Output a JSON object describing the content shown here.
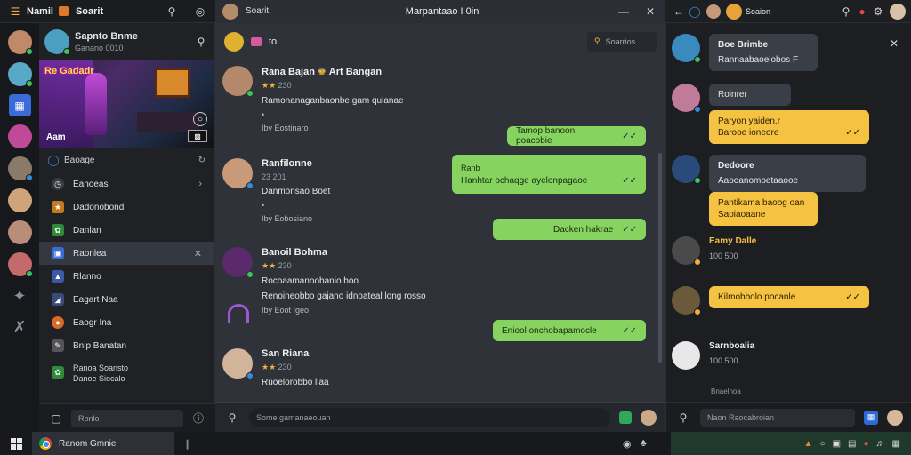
{
  "app": {
    "title": "Namil",
    "section": "Soarit"
  },
  "window": {
    "title": "Marpantaao I 0in"
  },
  "channel": {
    "name": "to"
  },
  "search": {
    "label": "Soarrios"
  },
  "top_right": {
    "label": "Soaion"
  },
  "sidebar": {
    "header": {
      "title": "Sapnto Bnme",
      "subtitle": "Ganano 0010"
    },
    "banner": {
      "tag": "Re Gadadr",
      "name": "Aam"
    },
    "section_label": "Baoage",
    "items": [
      {
        "label": "Eanoeas",
        "icon": "clock-icon",
        "color": "#3a3d44"
      },
      {
        "label": "Dadonobond",
        "icon": "star-icon",
        "color": "#c57a1e"
      },
      {
        "label": "Danlan",
        "icon": "leaf-icon",
        "color": "#2f8a3a"
      },
      {
        "label": "Raonlea",
        "icon": "square-icon",
        "color": "#3a6bd8",
        "active": true
      },
      {
        "label": "Rlanno",
        "icon": "triangle-icon",
        "color": "#3a5aa8"
      },
      {
        "label": "Eagart Naa",
        "icon": "image-icon",
        "color": "#3a4a7a"
      },
      {
        "label": "Eaogr Ina",
        "icon": "ball-icon",
        "color": "#d86a2a"
      },
      {
        "label": "Bnlp Banatan",
        "icon": "pen-icon",
        "color": "#555"
      }
    ],
    "multi_item": {
      "line1": "Ranoa Soansto",
      "line2": "Danoe Siocalo"
    },
    "footer": {
      "placeholder": "Rbnlo"
    }
  },
  "messages": [
    {
      "name": "Rana Bajan",
      "name_suffix": "Art Bangan",
      "meta": "230",
      "text": "Ramonanaganbaonbe gam quianae",
      "small": "Iby Eostinaro"
    },
    {
      "name": "Ranfilonne",
      "meta": "23 201",
      "text": "Danmonsao Boet",
      "small": "Iby Eobosiano"
    },
    {
      "name": "Banoil Bohma",
      "meta": "230",
      "text": "Rocoaamanoobanio boo",
      "text2": "Renoineobbo gajano idnoateal long rosso",
      "small": "Iby Eoot Igeo"
    },
    {
      "name": "San Riana",
      "meta": "230",
      "text": "Ruoelorobbo llaa"
    }
  ],
  "green_bubbles": [
    {
      "text": "Tamop banoon poacobie"
    },
    {
      "header": "Ranb",
      "text": "Hanhtar ochaqge ayelonpagaoe"
    },
    {
      "text": "Dacken hakrae"
    },
    {
      "text": "Eniool onchobapamocle"
    }
  ],
  "composer": {
    "placeholder": "Some gamanaeouan"
  },
  "right_panel": {
    "messages": [
      {
        "name": "Boe Brimbe",
        "text": "Rannaabaoelobos F",
        "style": "dark"
      },
      {
        "name": "",
        "text": "Roinrer",
        "style": "dark"
      },
      {
        "name": "",
        "text": "Paryon yaiden.r",
        "text2": "Barooe ioneore",
        "style": "yellow"
      },
      {
        "name": "Dedoore",
        "text": "Aaooanomoetaaooe",
        "style": "dark"
      },
      {
        "name": "",
        "text": "Pantikama baoog oan",
        "text2": "Saoiaoaane",
        "style": "yellow"
      },
      {
        "name": "Eamy Dalle",
        "meta": "100 500",
        "style": "none"
      },
      {
        "name": "",
        "text": "Kilmobbolo pocanle",
        "style": "yellow"
      },
      {
        "name": "Sarnboalia",
        "meta": "100 500",
        "style": "none"
      }
    ],
    "footer_label": "Bnaelnoa",
    "composer": {
      "placeholder": "Naon Raocabroian"
    }
  },
  "taskbar": {
    "app_label": "Ranom Gmnie"
  },
  "colors": {
    "accent_green": "#86d35f",
    "accent_yellow": "#f5c242",
    "accent_blue": "#3a6bd8"
  }
}
